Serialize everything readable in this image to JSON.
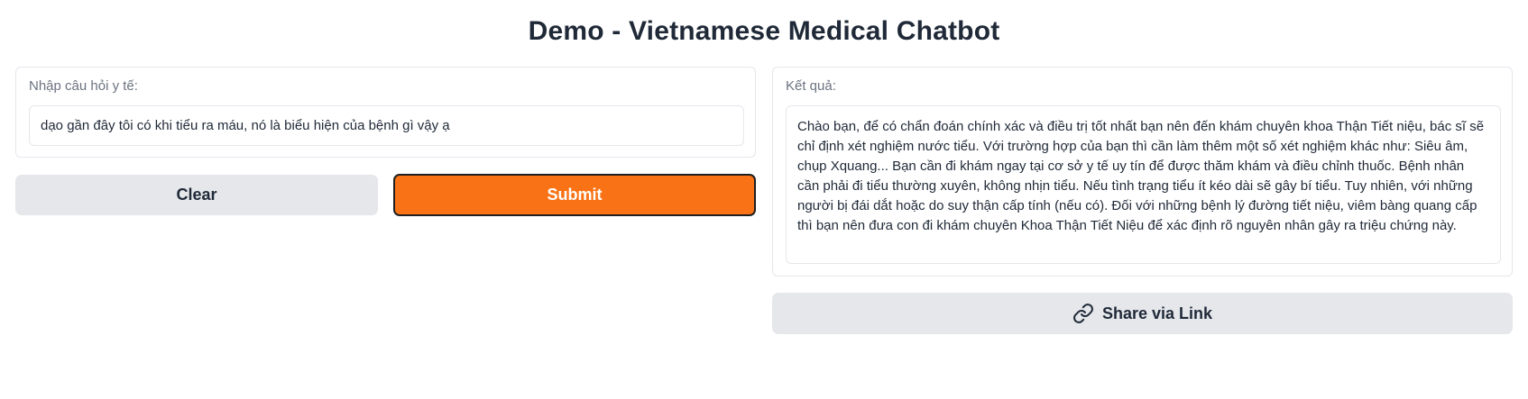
{
  "page": {
    "title": "Demo - Vietnamese Medical Chatbot"
  },
  "input_panel": {
    "label": "Nhập câu hỏi y tế:",
    "value": "dạo gần đây tôi có khi tiểu ra máu, nó là biểu hiện của bệnh gì vậy ạ"
  },
  "buttons": {
    "clear_label": "Clear",
    "submit_label": "Submit",
    "share_label": "Share via Link"
  },
  "output_panel": {
    "label": "Kết quả:",
    "answer": "Chào bạn, để có chẩn đoán chính xác và điều trị tốt nhất bạn nên đến khám chuyên khoa Thận Tiết niệu, bác sĩ sẽ chỉ định xét nghiệm nước tiểu. Với trường hợp của bạn thì cần làm thêm một số xét nghiệm khác như: Siêu âm, chụp Xquang... Bạn cần đi khám ngay tại cơ sở y tế uy tín để được thăm khám và điều chỉnh thuốc. Bệnh nhân cần phải đi tiểu thường xuyên, không nhịn tiểu. Nếu tình trạng tiểu ít kéo dài sẽ gây bí tiểu. Tuy nhiên, với những người bị đái dắt hoặc do suy thận cấp tính (nếu có). Đối với những bệnh lý đường tiết niệu, viêm bàng quang cấp thì bạn nên đưa con đi khám chuyên Khoa Thận Tiết Niệu để xác định rõ nguyên nhân gây ra triệu chứng này."
  },
  "icons": {
    "share": "link-icon"
  },
  "colors": {
    "submit_bg": "#f97316",
    "secondary_bg": "#e5e7eb",
    "text": "#1f2937",
    "label": "#6b7280"
  }
}
